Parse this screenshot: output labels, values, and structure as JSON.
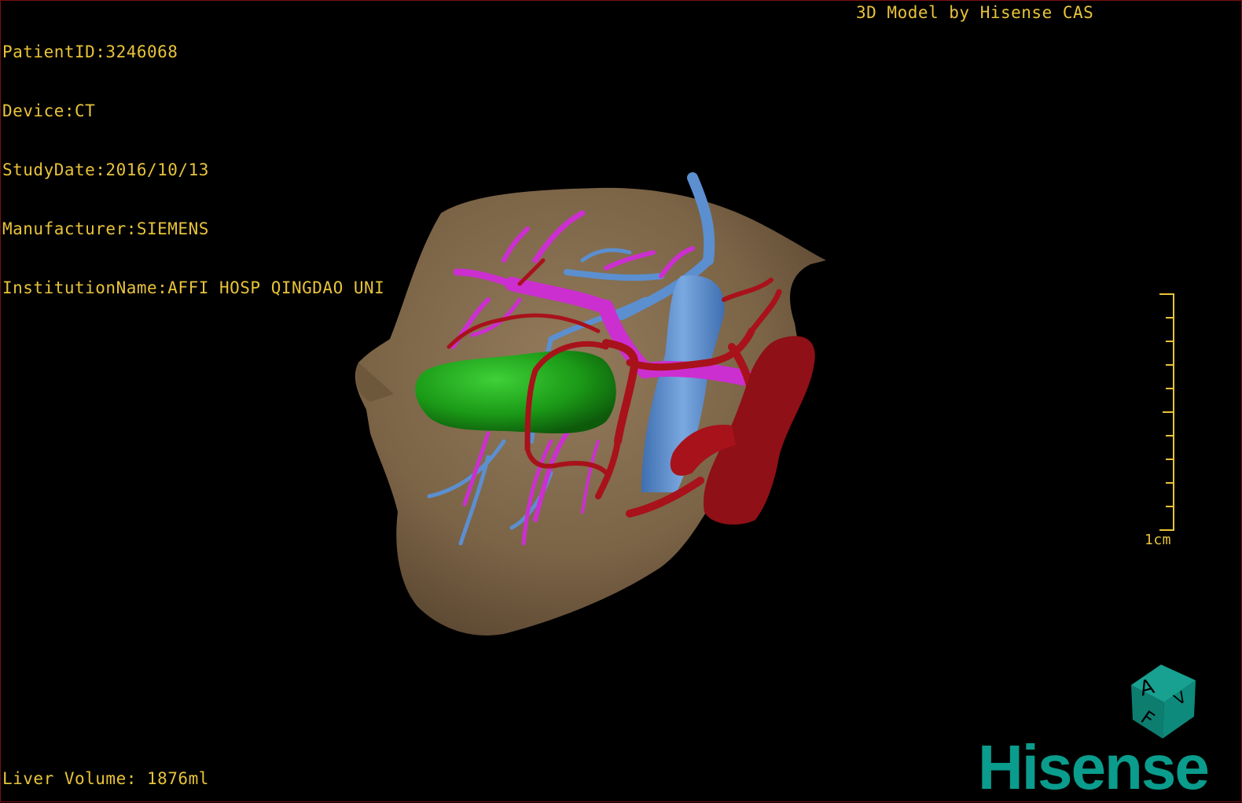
{
  "header": {
    "patient_id": "PatientID:3246068",
    "device": "Device:CT",
    "study_date": "StudyDate:2016/10/13",
    "manufacturer": "Manufacturer:SIEMENS",
    "institution": "InstitutionName:AFFI HOSP QINGDAO UNI",
    "credit": "3D Model by Hisense CAS"
  },
  "footer": {
    "liver_volume": "Liver Volume: 1876ml"
  },
  "scale": {
    "label": "1cm"
  },
  "orientation_cube": {
    "face_labels": [
      "A",
      "F",
      "V"
    ]
  },
  "brand": {
    "name": "Hisense",
    "color": "#0a9c8c"
  },
  "colors": {
    "overlay_text": "#e8c33a",
    "liver": "#8c7452",
    "tumor": "#1f9e1a",
    "portal_vein": "#cc2fd0",
    "hepatic_vein": "#5b8fd0",
    "artery": "#a8121a",
    "frame": "#7a1010"
  }
}
